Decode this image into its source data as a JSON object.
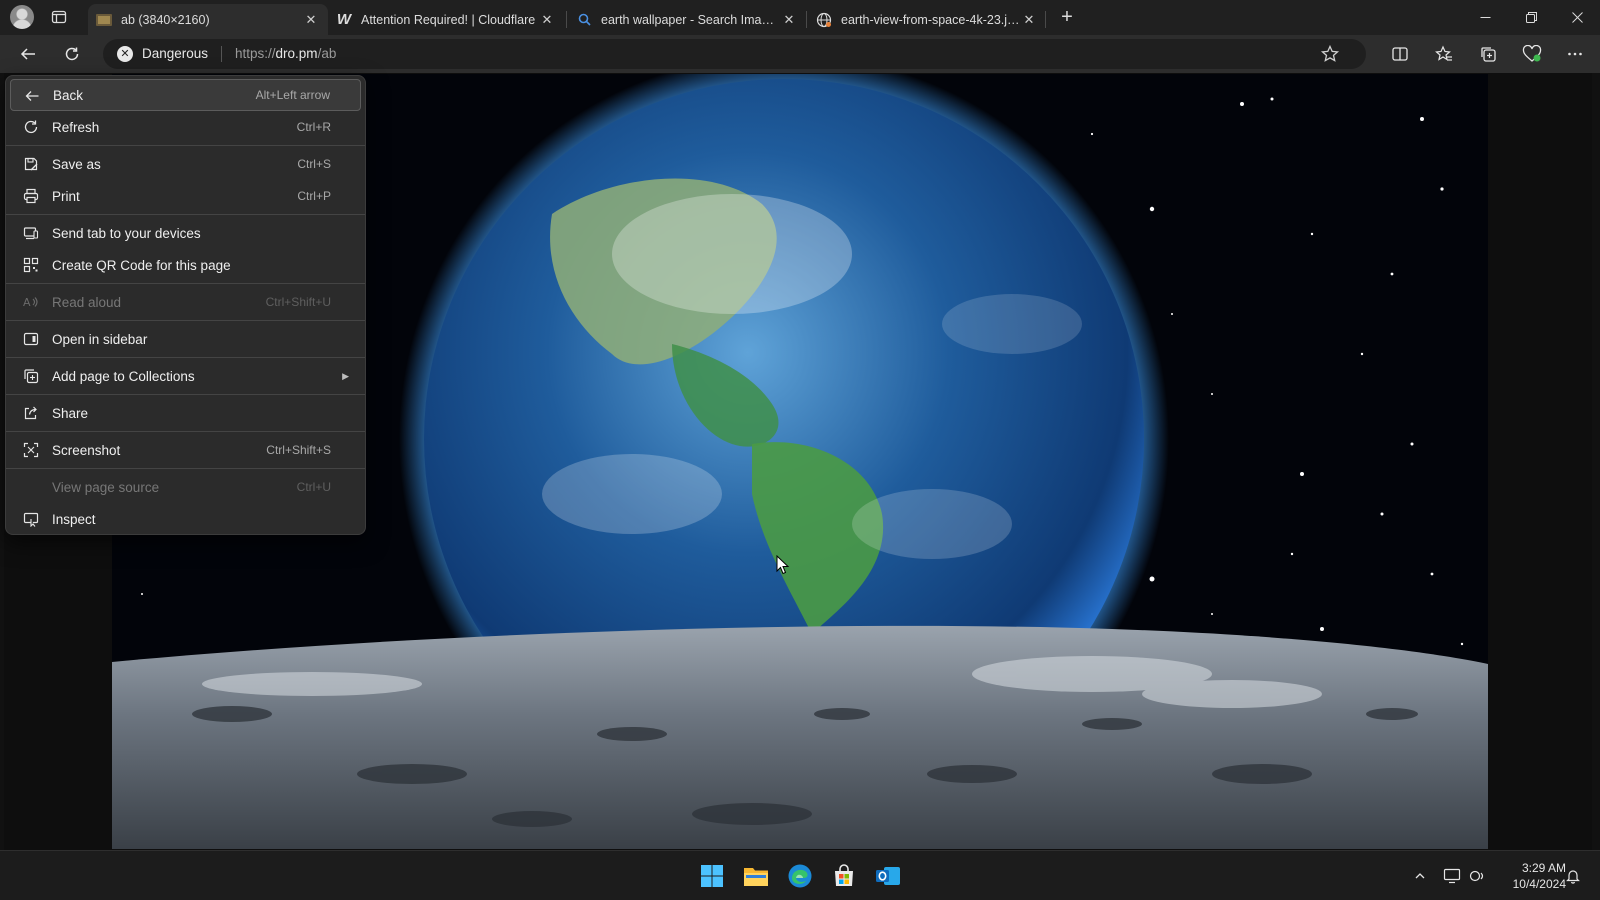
{
  "browser": {
    "tabs": [
      {
        "title": "ab (3840×2160)",
        "active": true
      },
      {
        "title": "Attention Required! | Cloudflare",
        "active": false
      },
      {
        "title": "earth wallpaper - Search Images",
        "active": false
      },
      {
        "title": "earth-view-from-space-4k-23.jpg",
        "active": false
      }
    ],
    "new_tab_icon": "plus-icon"
  },
  "address_bar": {
    "security_label": "Dangerous",
    "url_prefix": "https://",
    "url_domain": "dro.pm",
    "url_path": "/ab"
  },
  "context_menu": {
    "items": [
      {
        "label": "Back",
        "shortcut": "Alt+Left arrow",
        "icon": "arrow-left-icon",
        "enabled": true,
        "highlighted": true
      },
      {
        "label": "Refresh",
        "shortcut": "Ctrl+R",
        "icon": "refresh-icon",
        "enabled": true
      },
      {
        "label": "Save as",
        "shortcut": "Ctrl+S",
        "icon": "save-as-icon",
        "enabled": true
      },
      {
        "label": "Print",
        "shortcut": "Ctrl+P",
        "icon": "printer-icon",
        "enabled": true
      },
      {
        "label": "Send tab to your devices",
        "shortcut": "",
        "icon": "send-tab-icon",
        "enabled": true
      },
      {
        "label": "Create QR Code for this page",
        "shortcut": "",
        "icon": "qr-code-icon",
        "enabled": true
      },
      {
        "label": "Read aloud",
        "shortcut": "Ctrl+Shift+U",
        "icon": "read-aloud-icon",
        "enabled": false
      },
      {
        "label": "Open in sidebar",
        "shortcut": "",
        "icon": "sidebar-icon",
        "enabled": true
      },
      {
        "label": "Add page to Collections",
        "shortcut": "",
        "icon": "collections-icon",
        "enabled": true,
        "submenu": true
      },
      {
        "label": "Share",
        "shortcut": "",
        "icon": "share-icon",
        "enabled": true
      },
      {
        "label": "Screenshot",
        "shortcut": "Ctrl+Shift+S",
        "icon": "screenshot-icon",
        "enabled": true
      },
      {
        "label": "View page source",
        "shortcut": "Ctrl+U",
        "icon": "",
        "enabled": false
      },
      {
        "label": "Inspect",
        "shortcut": "",
        "icon": "inspect-icon",
        "enabled": true
      }
    ]
  },
  "taskbar": {
    "apps": [
      "windows-start-icon",
      "file-explorer-icon",
      "edge-icon",
      "microsoft-store-icon",
      "outlook-icon"
    ],
    "time": "3:29 AM",
    "date": "10/4/2024"
  },
  "colors": {
    "titlebar": "#202020",
    "toolbar": "#2d2d2d",
    "menu_bg": "#2b2b2b",
    "taskbar": "#1c1c1c"
  }
}
